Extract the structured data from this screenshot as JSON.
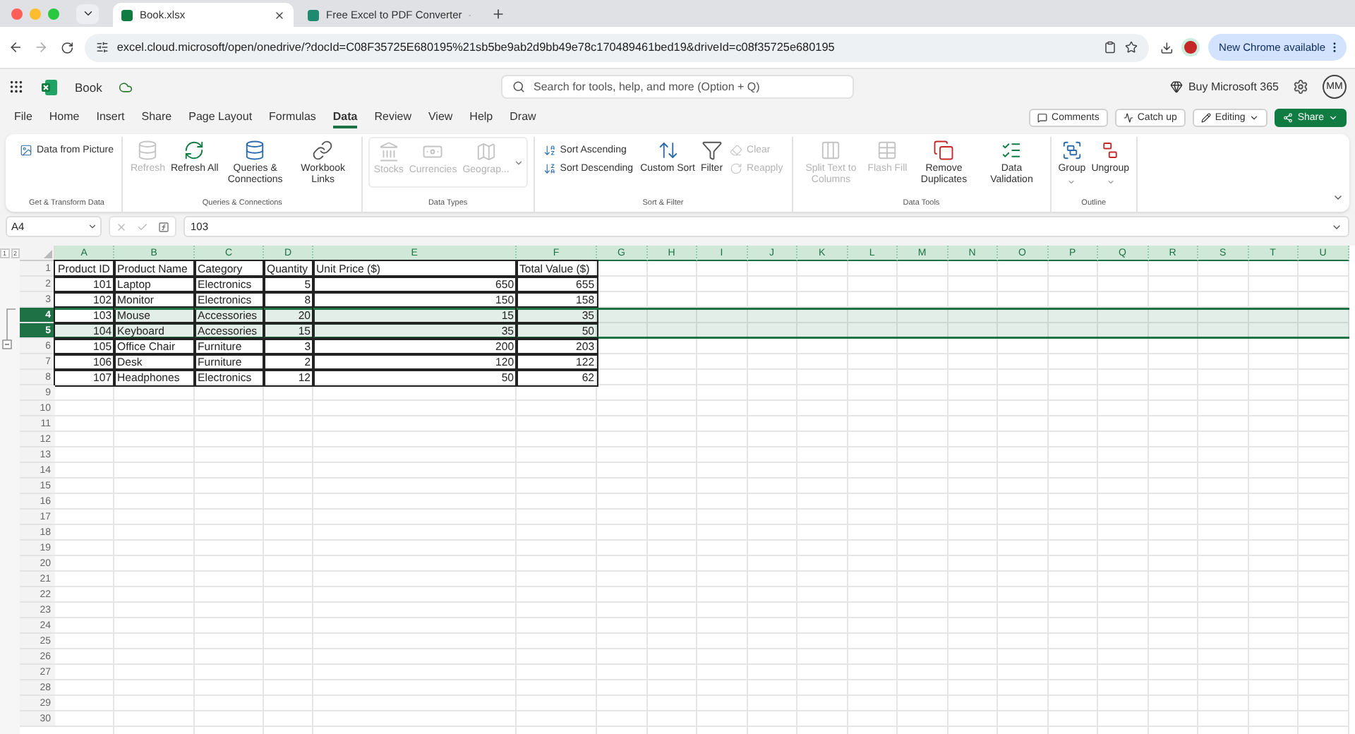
{
  "browser": {
    "tabs": [
      {
        "title": "Book.xlsx",
        "selected": true
      },
      {
        "title": "Free Excel to PDF Converter",
        "selected": false
      }
    ],
    "url": "excel.cloud.microsoft/open/onedrive/?docId=C08F35725E680195%21sb5be9ab2d9bb49e78c170489461bed19&driveId=c08f35725e680195",
    "update_button": "New Chrome available"
  },
  "app": {
    "file_name": "Book",
    "search_placeholder": "Search for tools, help, and more (Option + Q)",
    "buy_label": "Buy Microsoft 365",
    "avatar": "MM"
  },
  "menu_tabs": [
    {
      "label": "File",
      "selected": false
    },
    {
      "label": "Home",
      "selected": false
    },
    {
      "label": "Insert",
      "selected": false
    },
    {
      "label": "Share",
      "selected": false
    },
    {
      "label": "Page Layout",
      "selected": false
    },
    {
      "label": "Formulas",
      "selected": false
    },
    {
      "label": "Data",
      "selected": true
    },
    {
      "label": "Review",
      "selected": false
    },
    {
      "label": "View",
      "selected": false
    },
    {
      "label": "Help",
      "selected": false
    },
    {
      "label": "Draw",
      "selected": false
    }
  ],
  "actions": [
    {
      "label": "Comments",
      "kind": "outline"
    },
    {
      "label": "Catch up",
      "kind": "outline"
    },
    {
      "label": "Editing",
      "kind": "dropdown"
    },
    {
      "label": "Share",
      "kind": "primary"
    }
  ],
  "ribbon": {
    "groups": [
      {
        "label": "Get & Transform Data",
        "kind": "plain",
        "items": [
          {
            "label": "Data from Picture",
            "kind": "small",
            "disabled": false
          }
        ]
      },
      {
        "label": "Queries & Connections",
        "kind": "plain",
        "items": [
          {
            "label": "Refresh",
            "kind": "large",
            "disabled": true
          },
          {
            "label": "Refresh All",
            "kind": "large",
            "disabled": false
          },
          {
            "label": "Queries & Connections",
            "kind": "large",
            "disabled": false
          },
          {
            "label": "Workbook Links",
            "kind": "large",
            "disabled": false
          }
        ]
      },
      {
        "label": "Data Types",
        "kind": "gallery",
        "items": [
          {
            "label": "Stocks",
            "kind": "large",
            "disabled": true
          },
          {
            "label": "Currencies",
            "kind": "large",
            "disabled": true
          },
          {
            "label": "Geograp...",
            "kind": "large",
            "disabled": true
          }
        ]
      },
      {
        "label": "Sort & Filter",
        "kind": "plain",
        "items": [
          {
            "label": "Sort Ascending",
            "kind": "small",
            "disabled": false
          },
          {
            "label": "Sort Descending",
            "kind": "small",
            "disabled": false
          },
          {
            "label": "Custom Sort",
            "kind": "large",
            "disabled": false
          },
          {
            "label": "Filter",
            "kind": "large",
            "disabled": false
          },
          {
            "label": "Clear",
            "kind": "small",
            "disabled": true
          },
          {
            "label": "Reapply",
            "kind": "small",
            "disabled": true
          }
        ]
      },
      {
        "label": "Data Tools",
        "kind": "plain",
        "items": [
          {
            "label": "Split Text to Columns",
            "kind": "large",
            "disabled": true
          },
          {
            "label": "Flash Fill",
            "kind": "large",
            "disabled": true
          },
          {
            "label": "Remove Duplicates",
            "kind": "large",
            "disabled": false
          },
          {
            "label": "Data Validation",
            "kind": "large",
            "disabled": false
          }
        ]
      },
      {
        "label": "Outline",
        "kind": "plain",
        "items": [
          {
            "label": "Group",
            "kind": "large",
            "disabled": false,
            "dropdown": true
          },
          {
            "label": "Ungroup",
            "kind": "large",
            "disabled": false,
            "dropdown": true
          }
        ]
      }
    ]
  },
  "formula_bar": {
    "name_box": "A4",
    "value": "103"
  },
  "outline": {
    "levels": [
      "1",
      "2"
    ]
  },
  "sheet": {
    "columns": [
      {
        "label": "A",
        "highlighted": true
      },
      {
        "label": "B",
        "highlighted": true
      },
      {
        "label": "C",
        "highlighted": true
      },
      {
        "label": "D",
        "highlighted": true
      },
      {
        "label": "E",
        "highlighted": true
      },
      {
        "label": "F",
        "highlighted": true
      },
      {
        "label": "G",
        "highlighted": true
      },
      {
        "label": "H",
        "highlighted": true
      },
      {
        "label": "I",
        "highlighted": true
      },
      {
        "label": "J",
        "highlighted": true
      },
      {
        "label": "K",
        "highlighted": true
      },
      {
        "label": "L",
        "highlighted": true
      },
      {
        "label": "M",
        "highlighted": true
      },
      {
        "label": "N",
        "highlighted": true
      },
      {
        "label": "O",
        "highlighted": true
      },
      {
        "label": "P",
        "highlighted": true
      },
      {
        "label": "Q",
        "highlighted": true
      },
      {
        "label": "R",
        "highlighted": true
      },
      {
        "label": "S",
        "highlighted": true
      },
      {
        "label": "T",
        "highlighted": true
      },
      {
        "label": "U",
        "highlighted": true
      }
    ],
    "rows": [
      {
        "number": "1",
        "selected": false,
        "cells": [
          {
            "text": "Product ID",
            "kind": "text"
          },
          {
            "text": "Product Name",
            "kind": "text"
          },
          {
            "text": "Category",
            "kind": "text"
          },
          {
            "text": "Quantity",
            "kind": "text"
          },
          {
            "text": "Unit Price ($)",
            "kind": "text"
          },
          {
            "text": "Total Value ($)",
            "kind": "text"
          }
        ]
      },
      {
        "number": "2",
        "selected": false,
        "cells": [
          {
            "text": "101",
            "kind": "number"
          },
          {
            "text": "Laptop",
            "kind": "text"
          },
          {
            "text": "Electronics",
            "kind": "text"
          },
          {
            "text": "5",
            "kind": "number"
          },
          {
            "text": "650",
            "kind": "number"
          },
          {
            "text": "655",
            "kind": "number"
          }
        ]
      },
      {
        "number": "3",
        "selected": false,
        "cells": [
          {
            "text": "102",
            "kind": "number"
          },
          {
            "text": "Monitor",
            "kind": "text"
          },
          {
            "text": "Electronics",
            "kind": "text"
          },
          {
            "text": "8",
            "kind": "number"
          },
          {
            "text": "150",
            "kind": "number"
          },
          {
            "text": "158",
            "kind": "number"
          }
        ]
      },
      {
        "number": "4",
        "selected": true,
        "cells": [
          {
            "text": "103",
            "kind": "number",
            "active": true
          },
          {
            "text": "Mouse",
            "kind": "text",
            "active": false
          },
          {
            "text": "Accessories",
            "kind": "text",
            "active": false
          },
          {
            "text": "20",
            "kind": "number",
            "active": false
          },
          {
            "text": "15",
            "kind": "number",
            "active": false
          },
          {
            "text": "35",
            "kind": "number",
            "active": false
          }
        ]
      },
      {
        "number": "5",
        "selected": true,
        "cells": [
          {
            "text": "104",
            "kind": "number",
            "active": false
          },
          {
            "text": "Keyboard",
            "kind": "text",
            "active": false
          },
          {
            "text": "Accessories",
            "kind": "text",
            "active": false
          },
          {
            "text": "15",
            "kind": "number",
            "active": false
          },
          {
            "text": "35",
            "kind": "number",
            "active": false
          },
          {
            "text": "50",
            "kind": "number",
            "active": false
          }
        ]
      },
      {
        "number": "6",
        "selected": false,
        "cells": [
          {
            "text": "105",
            "kind": "number"
          },
          {
            "text": "Office Chair",
            "kind": "text"
          },
          {
            "text": "Furniture",
            "kind": "text"
          },
          {
            "text": "3",
            "kind": "number"
          },
          {
            "text": "200",
            "kind": "number"
          },
          {
            "text": "203",
            "kind": "number"
          }
        ]
      },
      {
        "number": "7",
        "selected": false,
        "cells": [
          {
            "text": "106",
            "kind": "number"
          },
          {
            "text": "Desk",
            "kind": "text"
          },
          {
            "text": "Furniture",
            "kind": "text"
          },
          {
            "text": "2",
            "kind": "number"
          },
          {
            "text": "120",
            "kind": "number"
          },
          {
            "text": "122",
            "kind": "number"
          }
        ]
      },
      {
        "number": "8",
        "selected": false,
        "cells": [
          {
            "text": "107",
            "kind": "number"
          },
          {
            "text": "Headphones",
            "kind": "text"
          },
          {
            "text": "Electronics",
            "kind": "text"
          },
          {
            "text": "12",
            "kind": "number"
          },
          {
            "text": "50",
            "kind": "number"
          },
          {
            "text": "62",
            "kind": "number"
          }
        ]
      },
      {
        "number": "9",
        "selected": false
      },
      {
        "number": "10",
        "selected": false
      },
      {
        "number": "11",
        "selected": false
      },
      {
        "number": "12",
        "selected": false
      },
      {
        "number": "13",
        "selected": false
      },
      {
        "number": "14",
        "selected": false
      },
      {
        "number": "15",
        "selected": false
      },
      {
        "number": "16",
        "selected": false
      },
      {
        "number": "17",
        "selected": false
      },
      {
        "number": "18",
        "selected": false
      },
      {
        "number": "19",
        "selected": false
      },
      {
        "number": "20",
        "selected": false
      },
      {
        "number": "21",
        "selected": false
      },
      {
        "number": "22",
        "selected": false
      },
      {
        "number": "23",
        "selected": false
      },
      {
        "number": "24",
        "selected": false
      },
      {
        "number": "25",
        "selected": false
      },
      {
        "number": "26",
        "selected": false
      },
      {
        "number": "27",
        "selected": false
      },
      {
        "number": "28",
        "selected": false
      },
      {
        "number": "29",
        "selected": false
      },
      {
        "number": "30",
        "selected": false
      }
    ]
  }
}
